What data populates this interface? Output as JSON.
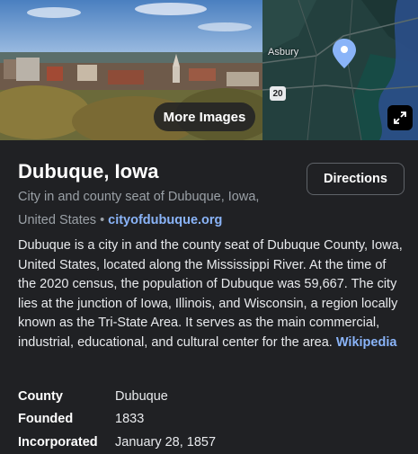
{
  "media": {
    "more_images_label": "More Images",
    "map_place_label": "Asbury",
    "route_shield": "20"
  },
  "place": {
    "title": "Dubuque, Iowa",
    "subtitle": "City in and county seat of Dubuque, Iowa, United States",
    "website": "cityofdubuque.org",
    "directions_label": "Directions",
    "description": "Dubuque is a city in and the county seat of Dubuque County, Iowa, United States, located along the Mississippi River. At the time of the 2020 census, the population of Dubuque was 59,667. The city lies at the junction of Iowa, Illinois, and Wisconsin, a region locally known as the Tri-State Area. It serves as the main commercial, industrial, educational, and cultural center for the area.",
    "source_link": "Wikipedia"
  },
  "facts": [
    {
      "key": "County",
      "value": "Dubuque"
    },
    {
      "key": "Founded",
      "value": "1833"
    },
    {
      "key": "Incorporated",
      "value": "January 28, 1857"
    }
  ],
  "colors": {
    "background": "#202124",
    "link": "#8ab4f8",
    "secondary_text": "#9aa0a6",
    "pin": "#8ab4f8"
  },
  "icons": {
    "map_pin": "location-pin-icon",
    "expand": "expand-icon"
  }
}
